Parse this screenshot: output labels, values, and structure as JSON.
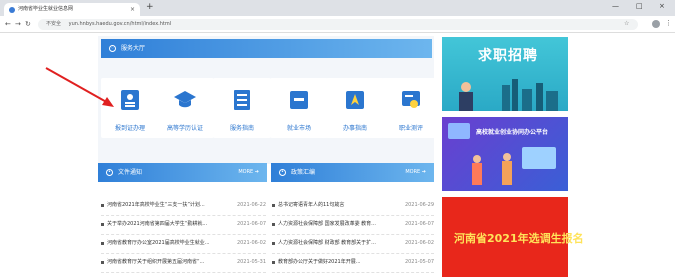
{
  "browser": {
    "tab_title": "河南省毕业生就业信息网",
    "tab_close": "×",
    "new_tab": "+",
    "address_security": "不安全",
    "address_url": "yun.hnbys.haedu.gov.cn/html/index.html",
    "window_controls": [
      "—",
      "□",
      "×"
    ]
  },
  "service_hall": {
    "title": "服务大厅",
    "items": [
      {
        "label": "报到证办理",
        "icon": "id-card-icon"
      },
      {
        "label": "高等学历认证",
        "icon": "graduation-cap-icon"
      },
      {
        "label": "服务指南",
        "icon": "document-list-icon"
      },
      {
        "label": "就业市场",
        "icon": "bookmark-icon"
      },
      {
        "label": "办事指南",
        "icon": "navigation-icon"
      },
      {
        "label": "职业测评",
        "icon": "certificate-icon"
      }
    ]
  },
  "notices": {
    "title": "文件通知",
    "more": "MORE",
    "items": [
      {
        "text": "河南省2021年高校毕业生“三支一扶”计划...",
        "date": "2021-06-22"
      },
      {
        "text": "关于举办2021河南省第四届大学生“勤耕就...",
        "date": "2021-06-07"
      },
      {
        "text": "河南省教育厅办公室2021届高校毕业生就业...",
        "date": "2021-06-02"
      },
      {
        "text": "河南省教育厅关于组织开展第五届河南省“...",
        "date": "2021-05-31"
      }
    ]
  },
  "policies": {
    "title": "政策汇编",
    "more": "MORE",
    "items": [
      {
        "text": "总书记寄语青年人的11句箴言",
        "date": "2021-06-29"
      },
      {
        "text": "人力资源社会保障部 国家发展改革委 教育...",
        "date": "2021-06-07"
      },
      {
        "text": "人力资源社会保障部 财政部 教育部关于扩...",
        "date": "2021-06-02"
      },
      {
        "text": "教育部办公厅关于做好2021年开展...",
        "date": "2021-05-07"
      }
    ]
  },
  "banners": {
    "job": "求职招聘",
    "platform": "高校就业创业协同办公平台",
    "selection": "河南省2021年选调生报名"
  },
  "colors": {
    "accent": "#2f7fd8",
    "link": "#2b76cf",
    "arrow": "#e02020",
    "banner_red": "#e8271b"
  }
}
